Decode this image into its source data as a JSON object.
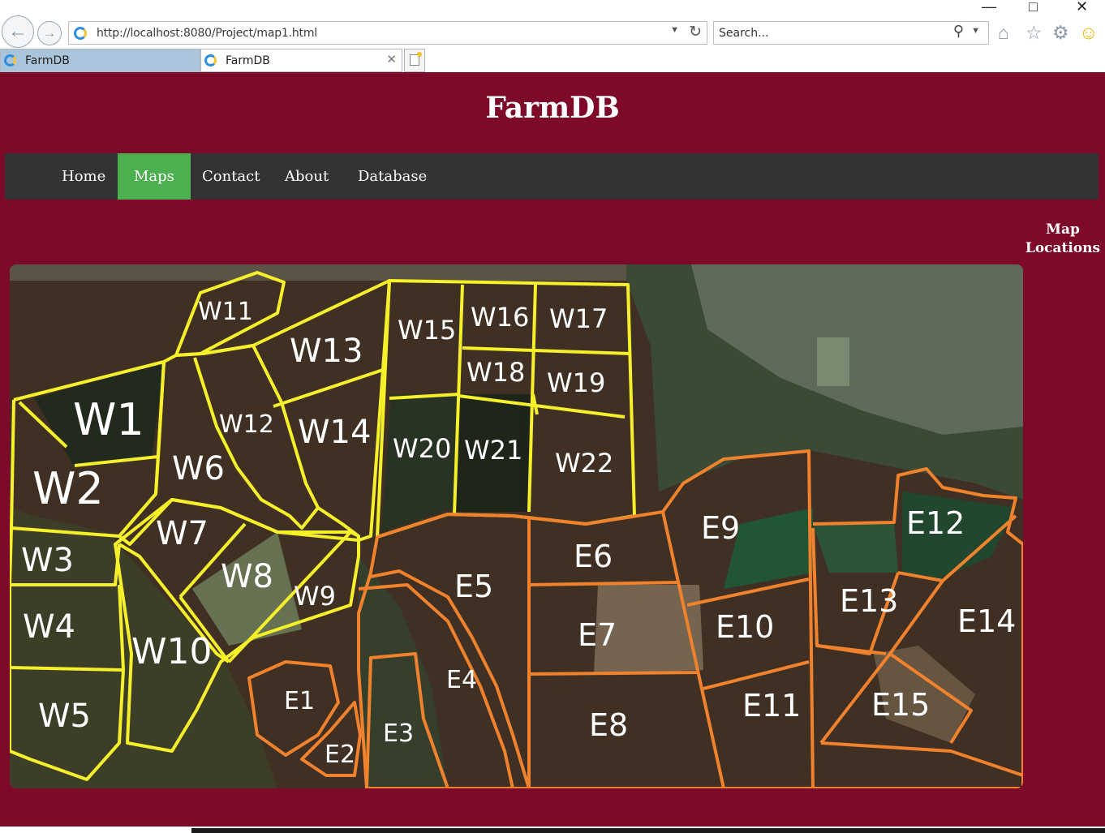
{
  "browser": {
    "url": "http://localhost:8080/Project/map1.html",
    "search_placeholder": "Search...",
    "tabs": [
      {
        "label": "FarmDB"
      },
      {
        "label": "FarmDB"
      }
    ]
  },
  "page": {
    "title": "FarmDB",
    "nav": [
      {
        "label": "Home"
      },
      {
        "label": "Maps"
      },
      {
        "label": "Contact"
      },
      {
        "label": "About"
      },
      {
        "label": "Database"
      }
    ],
    "active_nav": "Maps",
    "side_heading": "Map Locations"
  },
  "colors": {
    "page_bg": "#7c0a28",
    "navbar_bg": "#333333",
    "nav_active": "#4caf50",
    "west_outline": "#f5f02a",
    "east_outline": "#f0822e"
  },
  "map": {
    "plots": [
      "W1",
      "W2",
      "W3",
      "W4",
      "W5",
      "W6",
      "W7",
      "W8",
      "W9",
      "W10",
      "W11",
      "W12",
      "W13",
      "W14",
      "W15",
      "W16",
      "W17",
      "W18",
      "W19",
      "W20",
      "W21",
      "W22",
      "E1",
      "E2",
      "E3",
      "E4",
      "E5",
      "E6",
      "E7",
      "E8",
      "E9",
      "E10",
      "E11",
      "E12",
      "E13",
      "E14",
      "E15"
    ]
  }
}
